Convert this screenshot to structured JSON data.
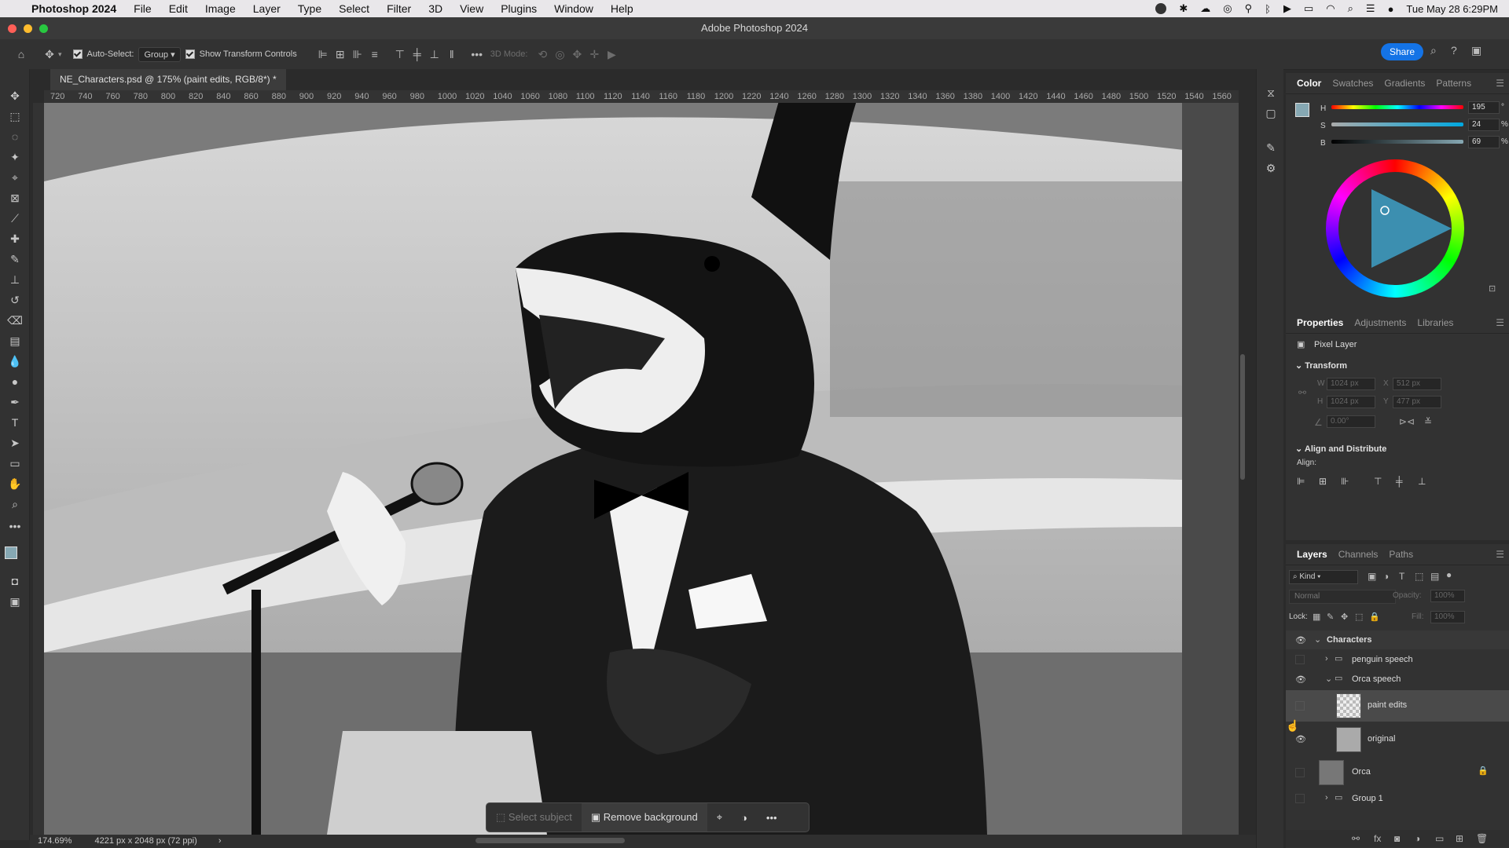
{
  "menubar": {
    "app_name": "Photoshop 2024",
    "items": [
      "File",
      "Edit",
      "Image",
      "Layer",
      "Type",
      "Select",
      "Filter",
      "3D",
      "View",
      "Plugins",
      "Window",
      "Help"
    ],
    "clock": "Tue May 28  6:29PM"
  },
  "window": {
    "title": "Adobe Photoshop 2024"
  },
  "options_bar": {
    "auto_select_label": "Auto-Select:",
    "auto_select_value": "Group",
    "show_transform_label": "Show Transform Controls",
    "mode_3d_label": "3D Mode:",
    "share_label": "Share"
  },
  "document": {
    "tab_title": "NE_Characters.psd @ 175% (paint edits, RGB/8*) *",
    "zoom": "174.69%",
    "doc_info": "4221 px x 2048 px (72 ppi)",
    "ruler_labels": [
      "720",
      "740",
      "760",
      "780",
      "800",
      "820",
      "840",
      "860",
      "880",
      "900",
      "920",
      "940",
      "960",
      "980",
      "1000",
      "1020",
      "1040",
      "1060",
      "1080",
      "1100",
      "1120",
      "1140",
      "1160",
      "1180",
      "1200",
      "1220",
      "1240",
      "1260",
      "1280",
      "1300",
      "1320",
      "1340",
      "1360",
      "1380",
      "1400",
      "1420",
      "1440",
      "1460",
      "1480",
      "1500",
      "1520",
      "1540",
      "1560"
    ]
  },
  "context_bar": {
    "select_subject": "Select subject",
    "remove_background": "Remove background"
  },
  "color_panel": {
    "tabs": [
      "Color",
      "Swatches",
      "Gradients",
      "Patterns"
    ],
    "h_label": "H",
    "h_value": "195",
    "h_unit": "°",
    "s_label": "S",
    "s_value": "24",
    "s_unit": "%",
    "b_label": "B",
    "b_value": "69",
    "b_unit": "%",
    "swatch_color": "#86a8b3"
  },
  "properties_panel": {
    "tabs": [
      "Properties",
      "Adjustments",
      "Libraries"
    ],
    "layer_type": "Pixel Layer",
    "transform_title": "Transform",
    "w_label": "W",
    "w_value": "1024 px",
    "h_label": "H",
    "h_value": "1024 px",
    "x_label": "X",
    "x_value": "512 px",
    "y_label": "Y",
    "y_value": "477 px",
    "angle_value": "0.00°",
    "align_title": "Align and Distribute",
    "align_label": "Align:"
  },
  "layers_panel": {
    "tabs": [
      "Layers",
      "Channels",
      "Paths"
    ],
    "filter_label": "Kind",
    "blend_mode": "Normal",
    "opacity_label": "Opacity:",
    "opacity_value": "100%",
    "lock_label": "Lock:",
    "fill_label": "Fill:",
    "fill_value": "100%",
    "layers": {
      "characters": "Characters",
      "penguin_speech": "penguin speech",
      "orca_speech": "Orca speech",
      "paint_edits": "paint edits",
      "original": "original",
      "orca": "Orca",
      "group1": "Group 1"
    }
  }
}
